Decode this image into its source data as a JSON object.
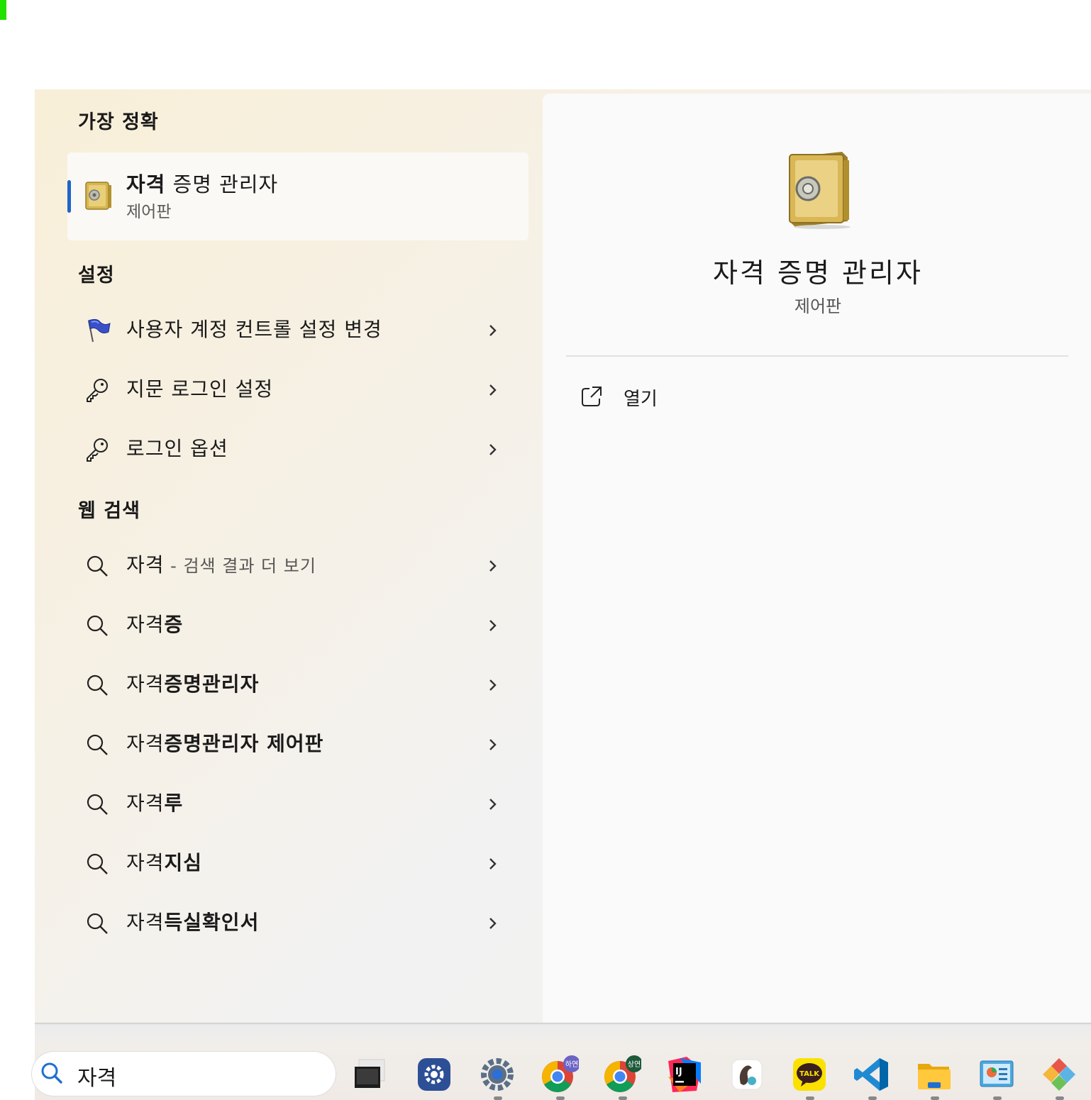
{
  "search": {
    "query": "자격"
  },
  "sections": {
    "best_match": "가장 정확",
    "settings": "설정",
    "web_search": "웹 검색"
  },
  "best_match": {
    "title_bold": "자격",
    "title_rest": " 증명 관리자",
    "subtitle": "제어판",
    "icon": "safe-icon"
  },
  "settings_items": [
    {
      "label": "사용자 계정 컨트롤 설정 변경",
      "icon": "uac-flag-icon"
    },
    {
      "label": "지문 로그인 설정",
      "icon": "key-icon"
    },
    {
      "label": "로그인 옵션",
      "icon": "key-icon"
    }
  ],
  "web_items": [
    {
      "prefix": "자격",
      "bold": "",
      "suffix": " - 검색 결과 더 보기"
    },
    {
      "prefix": "자격",
      "bold": "증",
      "suffix": ""
    },
    {
      "prefix": "자격",
      "bold": "증명관리자",
      "suffix": ""
    },
    {
      "prefix": "자격",
      "bold": "증명관리자 제어판",
      "suffix": ""
    },
    {
      "prefix": "자격",
      "bold": "루",
      "suffix": ""
    },
    {
      "prefix": "자격",
      "bold": "지심",
      "suffix": ""
    },
    {
      "prefix": "자격",
      "bold": "득실확인서",
      "suffix": ""
    }
  ],
  "detail": {
    "title": "자격 증명 관리자",
    "subtitle": "제어판",
    "actions": [
      {
        "label": "열기",
        "icon": "open-external-icon"
      }
    ]
  },
  "taskbar": {
    "apps": [
      {
        "name": "task-view-icon"
      },
      {
        "name": "settings-blue-icon"
      },
      {
        "name": "settings-gear-icon"
      },
      {
        "name": "chrome-profile-1-icon",
        "badge": "하연"
      },
      {
        "name": "chrome-profile-2-icon",
        "badge": "상연"
      },
      {
        "name": "intellij-icon",
        "badge": "IJ"
      },
      {
        "name": "squirrel-app-icon"
      },
      {
        "name": "kakaotalk-icon",
        "badge": "TALK"
      },
      {
        "name": "vscode-icon"
      },
      {
        "name": "file-explorer-icon"
      },
      {
        "name": "control-panel-icon"
      },
      {
        "name": "git-icon"
      }
    ]
  }
}
